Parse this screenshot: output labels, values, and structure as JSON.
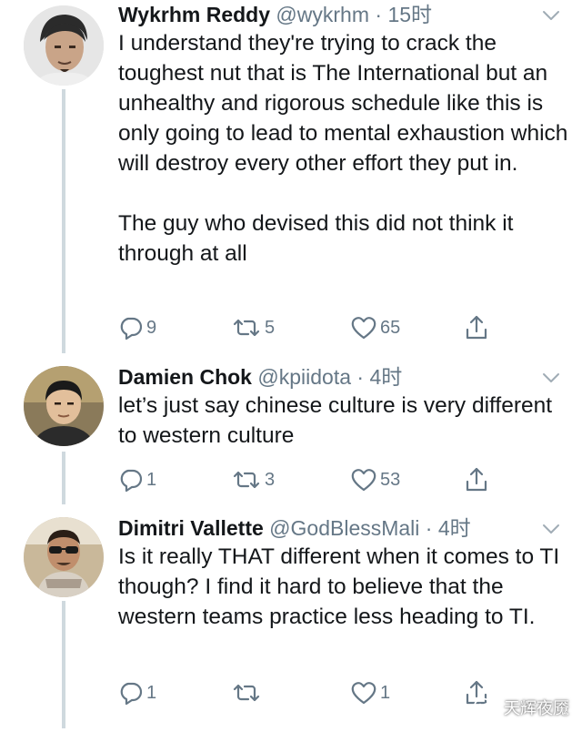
{
  "tweets": [
    {
      "name": "Wykrhm Reddy",
      "handle": "@wykrhm",
      "separator": "·",
      "time": "15时",
      "paragraphs": [
        "I understand they're trying to crack the toughest nut that is The International but an unhealthy and rigorous schedule like this is only going to lead to mental exhaustion which will destroy every other effort they put in.",
        "The guy who devised this did not think it through at all"
      ],
      "replies": "9",
      "retweets": "5",
      "likes": "65"
    },
    {
      "name": "Damien Chok",
      "handle": "@kpiidota",
      "separator": "·",
      "time": "4时",
      "paragraphs": [
        "let’s just say chinese culture is very different to western culture"
      ],
      "replies": "1",
      "retweets": "3",
      "likes": "53"
    },
    {
      "name": "Dimitri Vallette",
      "handle": "@GodBlessMali",
      "separator": "·",
      "time": "4时",
      "paragraphs": [
        "Is it really THAT different when it comes to TI though? I find it hard to believe that the western teams practice less heading to TI."
      ],
      "replies": "1",
      "retweets": "",
      "likes": "1"
    }
  ],
  "watermark": {
    "text": "天辉夜魇"
  },
  "icons": {
    "reply": "reply-icon",
    "retweet": "retweet-icon",
    "like": "heart-icon",
    "share": "share-icon",
    "more": "chevron-down-icon",
    "watermark": "wechat-icon"
  },
  "colors": {
    "text": "#14171a",
    "secondary": "#657786",
    "thread_line": "#cfd9de"
  }
}
